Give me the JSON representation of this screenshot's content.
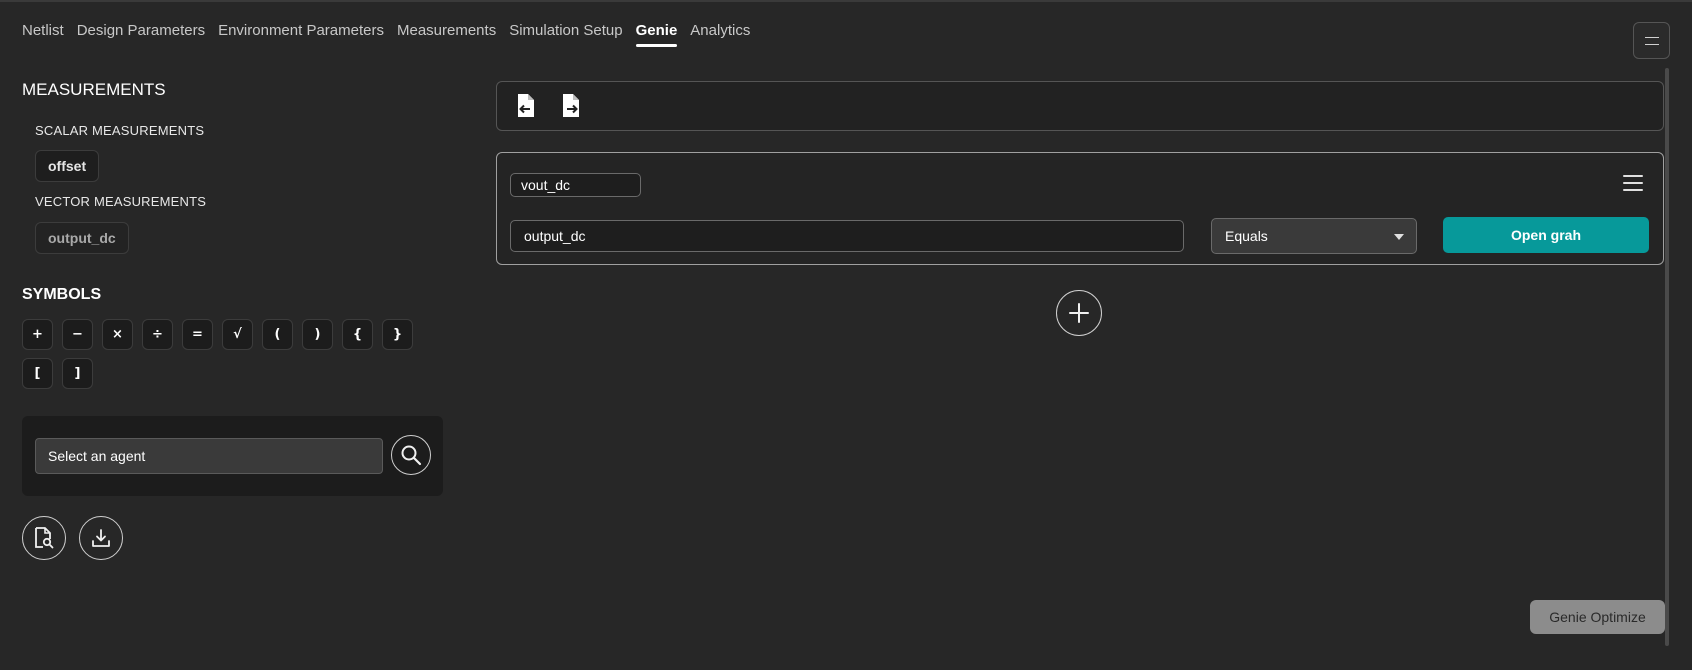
{
  "tabs": [
    {
      "label": "Netlist"
    },
    {
      "label": "Design Parameters"
    },
    {
      "label": "Environment Parameters"
    },
    {
      "label": "Measurements"
    },
    {
      "label": "Simulation Setup"
    },
    {
      "label": "Genie",
      "active": true
    },
    {
      "label": "Analytics"
    }
  ],
  "sidebar": {
    "measurements_heading": "MEASUREMENTS",
    "scalar_heading": "SCALAR MEASUREMENTS",
    "scalar_items": [
      "offset"
    ],
    "vector_heading": "VECTOR MEASUREMENTS",
    "vector_items": [
      "output_dc"
    ],
    "symbols_heading": "SYMBOLS",
    "symbols": [
      "+",
      "−",
      "×",
      "÷",
      "=",
      "√",
      "(",
      ")",
      "{",
      "}",
      "[",
      "]"
    ],
    "agent_placeholder": "Select an agent"
  },
  "editor": {
    "measurement_name": "vout_dc",
    "expression": "output_dc",
    "condition": "Equals",
    "open_graph_label": "Open grah"
  },
  "footer": {
    "optimize_label": "Genie Optimize"
  },
  "colors": {
    "background": "#272727",
    "accent": "#07999a",
    "panel": "#1c1c1c"
  }
}
